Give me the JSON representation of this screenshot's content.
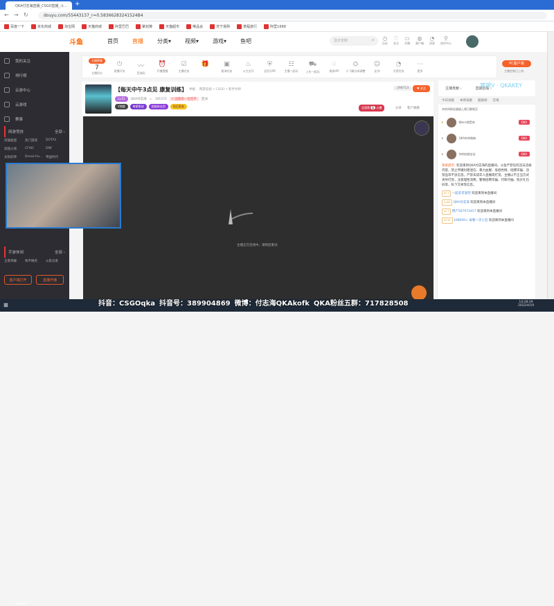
{
  "browser": {
    "tab_title": "QKA付志海直播_CSGO直播_斗...",
    "url": "douyu.com/55443137_r=0.58366283241524B4",
    "new_tab": "+"
  },
  "bookmarks": [
    "百度一下",
    "京东商城",
    "淘宝网",
    "天猫商城",
    "阿里巴巴",
    "聚划算",
    "天猫超市",
    "唯品会",
    "苏宁易购",
    "携程旅行",
    "阿里1688"
  ],
  "header": {
    "logo": "斗鱼",
    "nav": [
      "首页",
      "直播",
      "分类▾",
      "视频▾",
      "游戏▾",
      "鱼吧"
    ],
    "search_placeholder": "显示定制",
    "icons": [
      {
        "label": "历史",
        "icon": "clock-icon"
      },
      {
        "label": "关注",
        "icon": "heart-icon"
      },
      {
        "label": "开播",
        "icon": "camera-icon"
      },
      {
        "label": "客户端",
        "icon": "download-icon"
      },
      {
        "label": "消息",
        "icon": "bell-icon"
      },
      {
        "label": "创作中心",
        "icon": "bulb-icon"
      }
    ]
  },
  "sidebar": {
    "items": [
      "我的关注",
      "排行榜",
      "云游中心",
      "云游戏",
      "赛事"
    ],
    "section1": {
      "title": "网游竞技",
      "more": "全部 ›",
      "games": [
        "英雄联盟",
        "热门游戏",
        "DOTA2",
        "穿越火线",
        "CFHD",
        "DNF",
        "太阳武神",
        "Dread Hu...",
        "帝国时代"
      ]
    },
    "section2": {
      "title": "手游休闲",
      "more": "全部 ›",
      "games": [
        "王者荣耀",
        "和平精英",
        "火影忍者"
      ]
    },
    "buttons": [
      "客户端打开",
      "直播开播"
    ]
  },
  "toolbar": {
    "badge": "主播荣誉",
    "score": "7",
    "score_label": "主播积分",
    "items": [
      "直播开关",
      "音流码",
      "开播提醒",
      "主播任务",
      "",
      "星海任务",
      "火力全开",
      "全民乐PK",
      "主播一起玩",
      "上车一起玩",
      "贵族VIP",
      "小飞碟分成调整",
      "友邻",
      "为您任务",
      "更多"
    ],
    "pc_button": "PC客户端",
    "pc_sub": "主播定制已上线"
  },
  "room": {
    "title": "【每天中午3点见 康复训练】",
    "report": "举报",
    "category": "网游竞技 • CSGO • 新手导师",
    "level": "Lv.61",
    "streamer": "QKA付志海",
    "heat": "191572",
    "rank_badge": "V 国服第一坦克手",
    "location": "亚洲",
    "tags": [
      "V岗楼",
      "每星挑战",
      "超级粉丝团",
      "钻石贵族"
    ],
    "followers": "298713",
    "follow": "关注",
    "hot_rank": "全国第",
    "hot_num": "1",
    "hot_suffix": "火爆",
    "share": "分享",
    "client_watch": "客户端看"
  },
  "video": {
    "status": "主播正在连线中，请稍后重试"
  },
  "chat": {
    "tabs_top": [
      "主播贡献 ›",
      "直播回看 ›"
    ],
    "tabs": [
      "今日贡献",
      "本周贡献",
      "超级榜",
      "在线"
    ],
    "notice": "本房间粉丝量级上周已解锁至",
    "ranks": [
      {
        "name": "想eco就是肉",
        "badge": "QKA"
      },
      {
        "name": "QKA的李微楠",
        "badge": "QKA"
      },
      {
        "name": "你的姑娘苦苦",
        "badge": "QKA"
      }
    ],
    "system_label": "系统提示:",
    "system": "欢迎来到QKA付志海的直播间。斗鱼严禁任何违法违规内容，禁止传播封建迷信、暴力血腥、低俗色情、招嫖诈骗、违禁品等不良信息。严禁未成年人直播或打赏。主播以不正当方式诱导打赏，注意理性消费，警惕招聘诈骗、代练代抽、购买礼包码等，私下交易等信息。",
    "messages": [
      {
        "lv": "LV 7",
        "user": "一起去可爱吧",
        "text": "欢迎来到本直播间"
      },
      {
        "lv": "Lv.61",
        "user": "QKA付志海",
        "text": "欢迎来到本直播间"
      },
      {
        "lv": "LV 7",
        "user": "用户567972457",
        "text": "欢迎来到本直播间"
      },
      {
        "lv": "LV 24",
        "user": "168000+ 再看一次小丑",
        "text": "欢迎来到本直播间"
      }
    ],
    "watermark": "梦想V · QKAKEY"
  },
  "overlay": {
    "items": [
      "抖音：CSGOqka",
      "抖音号：389904869",
      "微博：付志海QKAkofk",
      "QKA粉丝五群：717828508"
    ]
  },
  "taskbar": {
    "app": "Steam",
    "time": "14:28:29",
    "date": "2022/4/19"
  },
  "colors": {
    "accent": "#ff6a00",
    "browser": "#2b6bd4",
    "sidebar": "#2c2c32"
  }
}
